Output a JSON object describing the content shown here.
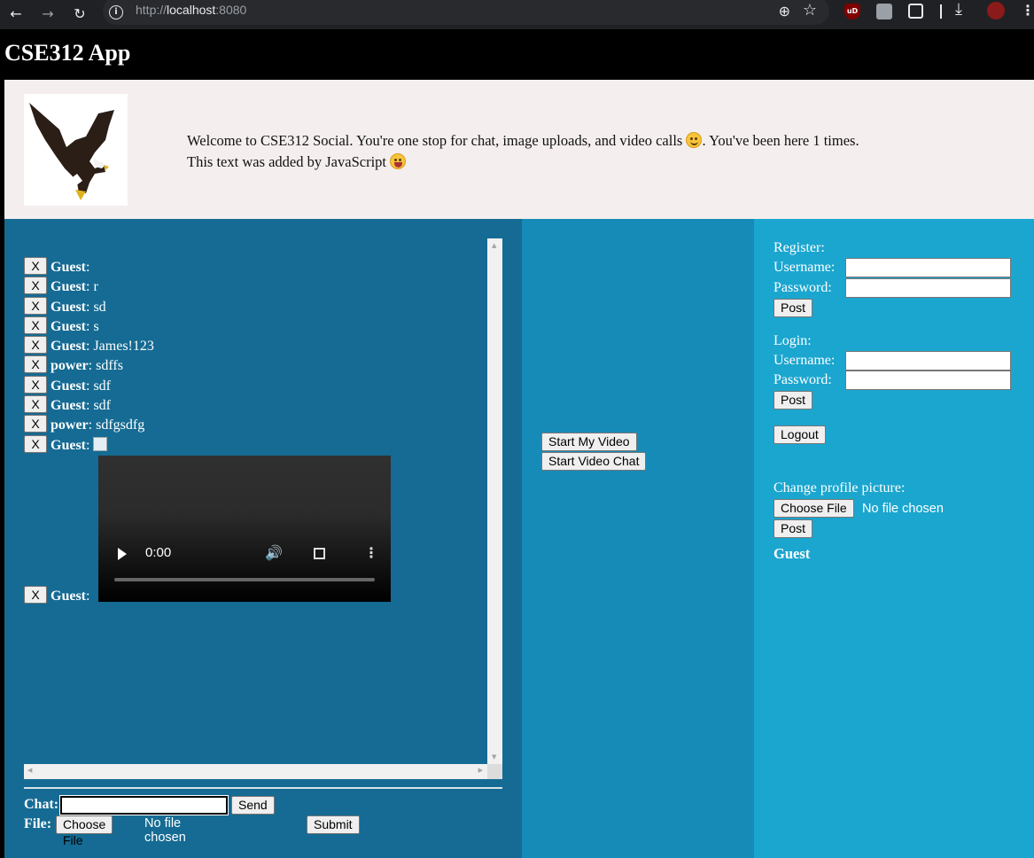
{
  "browser": {
    "url_scheme": "http://",
    "url_host": "localhost",
    "url_port": ":8080",
    "back_icon": "←",
    "forward_icon": "→",
    "reload_icon": "↻",
    "info_icon": "i",
    "zoom_icon": "⊕",
    "star_icon": "☆",
    "ublock_label": "uD",
    "download_icon": "⤓",
    "menu_icon": "⋮"
  },
  "header": {
    "title": "CSE312 App"
  },
  "banner": {
    "welcome_before": "Welcome to CSE312 Social. You're one stop for chat, image uploads, and video calls",
    "welcome_after": ". You've been here 1 times.",
    "js_text": "This text was added by JavaScript"
  },
  "chat": {
    "delete_label": "X",
    "messages": [
      {
        "user": "Guest",
        "text": ""
      },
      {
        "user": "Guest",
        "text": "r"
      },
      {
        "user": "Guest",
        "text": "sd"
      },
      {
        "user": "Guest",
        "text": "s"
      },
      {
        "user": "Guest",
        "text": "James!123"
      },
      {
        "user": "power",
        "text": "sdffs"
      },
      {
        "user": "Guest",
        "text": "sdf"
      },
      {
        "user": "Guest",
        "text": "sdf"
      },
      {
        "user": "power",
        "text": "sdfgsdfg"
      },
      {
        "user": "Guest",
        "text": ""
      },
      {
        "user": "Guest",
        "text": ""
      }
    ],
    "video": {
      "time": "0:00",
      "volume_icon": "🔊",
      "more_icon": "⋮"
    },
    "chat_label": "Chat:",
    "send_label": "Send",
    "file_label": "File:",
    "choose_file_label": "Choose File",
    "no_file_label": "No file chosen",
    "submit_label": "Submit"
  },
  "video_controls": {
    "start_my_video": "Start My Video",
    "start_video_chat": "Start Video Chat"
  },
  "auth": {
    "register_heading": "Register:",
    "login_heading": "Login:",
    "username_label": "Username:",
    "password_label": "Password:",
    "post_label": "Post",
    "logout_label": "Logout",
    "profile_heading": "Change profile picture:",
    "choose_file_label": "Choose File",
    "no_file_label": "No file chosen",
    "current_user": "Guest"
  }
}
